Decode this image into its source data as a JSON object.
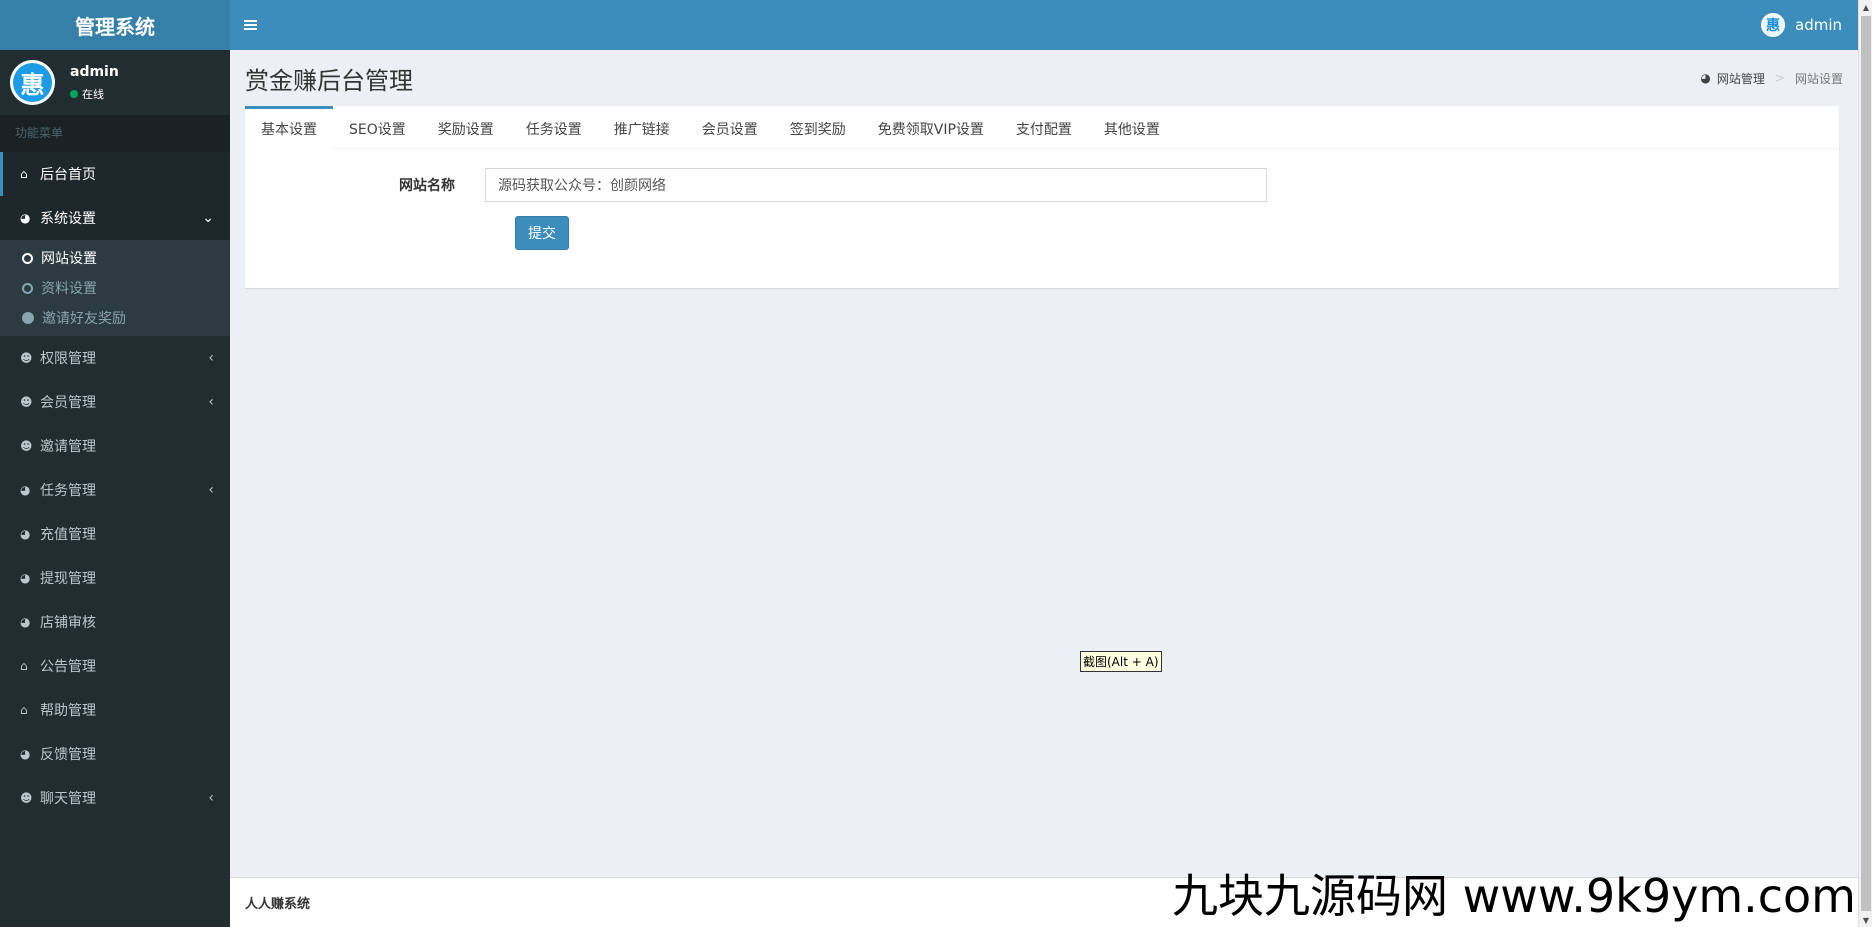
{
  "app": {
    "logo_text": "管理系统",
    "username": "admin"
  },
  "sidebar": {
    "user_name": "admin",
    "user_status": "在线",
    "avatar_char": "惠",
    "menu_header": "功能菜单",
    "items": [
      {
        "label": "后台首页",
        "icon": "home-icon"
      },
      {
        "label": "系统设置",
        "icon": "dashboard-icon"
      },
      {
        "label": "权限管理",
        "icon": "users-icon"
      },
      {
        "label": "会员管理",
        "icon": "users-icon"
      },
      {
        "label": "邀请管理",
        "icon": "users-icon"
      },
      {
        "label": "任务管理",
        "icon": "dashboard-icon"
      },
      {
        "label": "充值管理",
        "icon": "dashboard-icon"
      },
      {
        "label": "提现管理",
        "icon": "dashboard-icon"
      },
      {
        "label": "店铺审核",
        "icon": "dashboard-icon"
      },
      {
        "label": "公告管理",
        "icon": "home-icon"
      },
      {
        "label": "帮助管理",
        "icon": "home-icon"
      },
      {
        "label": "反馈管理",
        "icon": "dashboard-icon"
      },
      {
        "label": "聊天管理",
        "icon": "users-icon"
      }
    ],
    "submenu": [
      {
        "label": "网站设置"
      },
      {
        "label": "资料设置"
      },
      {
        "label": "邀请好友奖励"
      }
    ]
  },
  "content": {
    "page_title": "赏金赚后台管理",
    "breadcrumb": [
      "网站管理",
      "网站设置"
    ],
    "tabs": [
      "基本设置",
      "SEO设置",
      "奖励设置",
      "任务设置",
      "推广链接",
      "会员设置",
      "签到奖励",
      "免费领取VIP设置",
      "支付配置",
      "其他设置"
    ],
    "form": {
      "label": "网站名称",
      "value": "源码获取公众号：创颜网络",
      "submit_label": "提交"
    },
    "tooltip": "截图(Alt + A)"
  },
  "footer": {
    "text": "人人赚系统",
    "watermark": "九块九源码网 www.9k9ym.com"
  },
  "colors": {
    "header": "#3c8dbc",
    "logo_bg": "#367fa9",
    "sidebar_bg": "#222d32",
    "content_bg": "#ecf0f5"
  }
}
